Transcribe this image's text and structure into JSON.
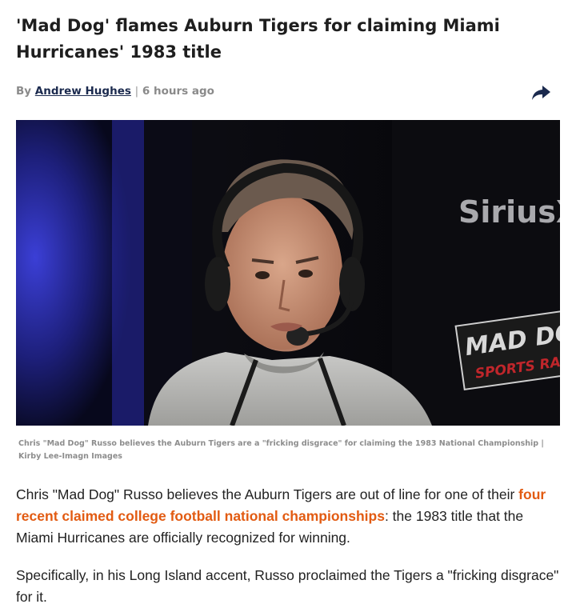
{
  "article": {
    "title": "'Mad Dog' flames Auburn Tigers for claiming Miami Hurricanes' 1983 title",
    "byline_prefix": "By",
    "author": "Andrew Hughes",
    "separator": "|",
    "time_ago": "6 hours ago",
    "share_icon": "share-arrow-icon",
    "image": {
      "backdrop_logo_text": "SiriusX",
      "banner_line1": "MAD DOG",
      "banner_line2": "SPORTS RADIO"
    },
    "caption": "Chris \"Mad Dog\" Russo believes the Auburn Tigers are a \"fricking disgrace\" for claiming the 1983 National Championship | Kirby Lee-Imagn Images",
    "paragraph1": {
      "before_link": "Chris \"Mad Dog\" Russo believes the Auburn Tigers are out of line for one of their ",
      "link_text": "four recent claimed college football national championships",
      "after_link": ": the 1983 title that the Miami Hurricanes are officially recognized for winning."
    },
    "paragraph2": "Specifically, in his Long Island accent, Russo proclaimed the Tigers a \"fricking disgrace\" for it."
  },
  "colors": {
    "link_accent": "#e25b12",
    "author_link": "#1b2a4e",
    "share_icon": "#1b2a4e"
  }
}
